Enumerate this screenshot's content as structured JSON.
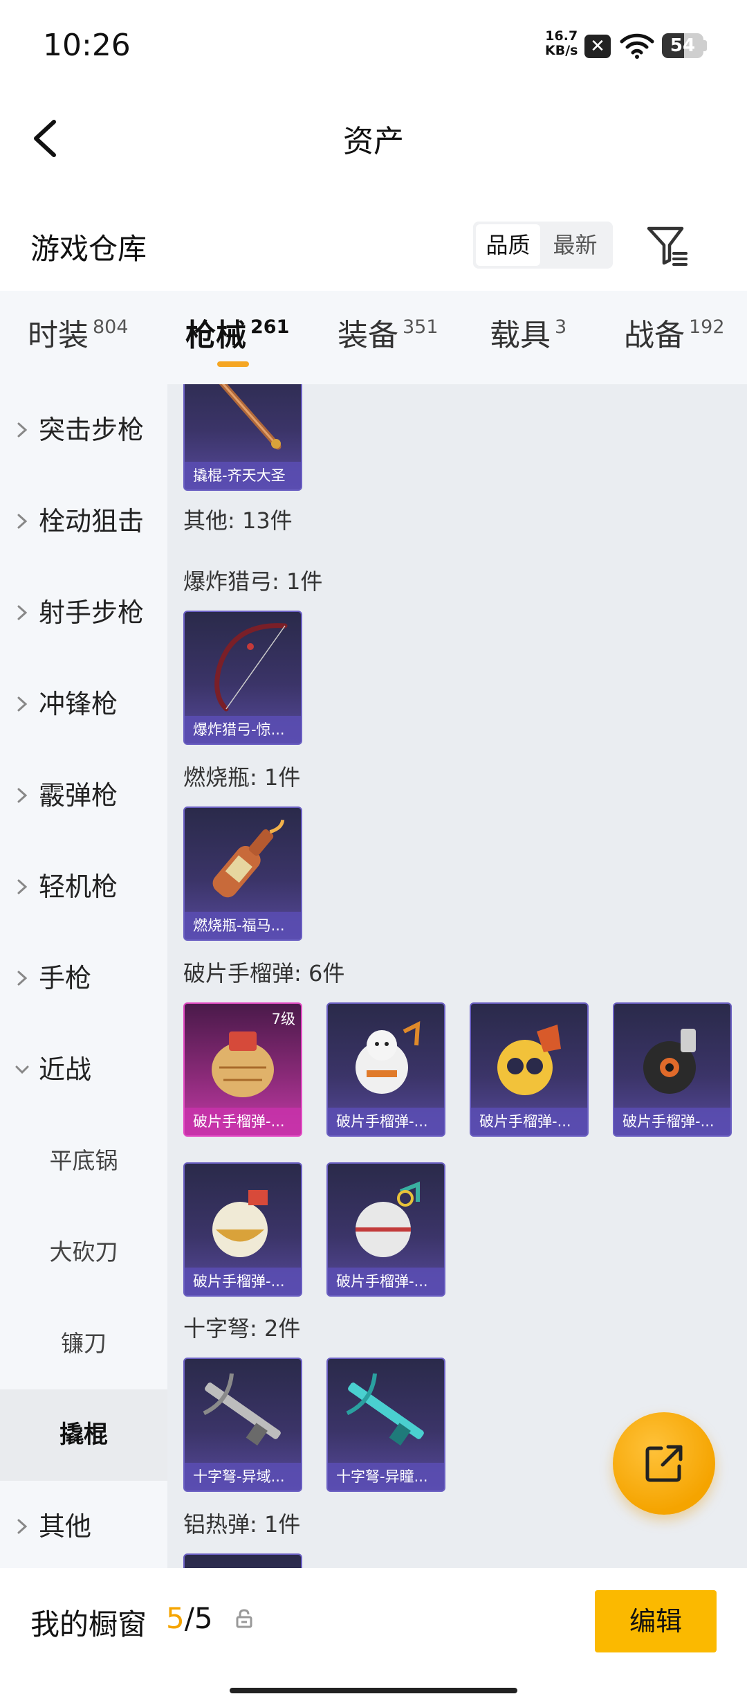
{
  "status": {
    "time": "10:26",
    "speed_value": "16.7",
    "speed_unit": "KB/s",
    "battery": "54",
    "battery_level": 0.54
  },
  "header": {
    "title": "资产"
  },
  "warehouse": {
    "title": "游戏仓库",
    "sort_quality": "品质",
    "sort_latest": "最新"
  },
  "tabs": [
    {
      "label": "时装",
      "count": "804"
    },
    {
      "label": "枪械",
      "count": "261"
    },
    {
      "label": "装备",
      "count": "351"
    },
    {
      "label": "载具",
      "count": "3"
    },
    {
      "label": "战备",
      "count": "192"
    }
  ],
  "sidebar": {
    "items": [
      {
        "label": "突击步枪"
      },
      {
        "label": "栓动狙击"
      },
      {
        "label": "射手步枪"
      },
      {
        "label": "冲锋枪"
      },
      {
        "label": "霰弹枪"
      },
      {
        "label": "轻机枪"
      },
      {
        "label": "手枪"
      },
      {
        "label": "近战"
      },
      {
        "label": "其他"
      }
    ],
    "subitems": [
      {
        "label": "平底锅"
      },
      {
        "label": "大砍刀"
      },
      {
        "label": "镰刀"
      },
      {
        "label": "撬棍"
      }
    ]
  },
  "content": {
    "top_card": "撬棍-齐天大圣",
    "groups": [
      {
        "label": "其他: 13件"
      },
      {
        "label": "爆炸猎弓: 1件"
      },
      {
        "label": "燃烧瓶: 1件"
      },
      {
        "label": "破片手榴弹: 6件"
      },
      {
        "label": "十字弩: 2件"
      },
      {
        "label": "铝热弹: 1件"
      }
    ],
    "cards": {
      "bow": "爆炸猎弓-惊...",
      "molotov": "燃烧瓶-福马...",
      "grenades": [
        {
          "label": "破片手榴弹-...",
          "level": "7级"
        },
        {
          "label": "破片手榴弹-..."
        },
        {
          "label": "破片手榴弹-..."
        },
        {
          "label": "破片手榴弹-..."
        },
        {
          "label": "破片手榴弹-..."
        },
        {
          "label": "破片手榴弹-..."
        }
      ],
      "crossbows": [
        {
          "label": "十字弩-异域..."
        },
        {
          "label": "十字弩-异瞳..."
        }
      ]
    }
  },
  "bottom": {
    "window_label": "我的橱窗",
    "current": "5",
    "total": "/5",
    "edit": "编辑"
  },
  "colors": {
    "accent": "#f5a400",
    "edit_button": "#fbb900",
    "card_purple": "#574a9c",
    "card_pink": "#c23aa6"
  }
}
